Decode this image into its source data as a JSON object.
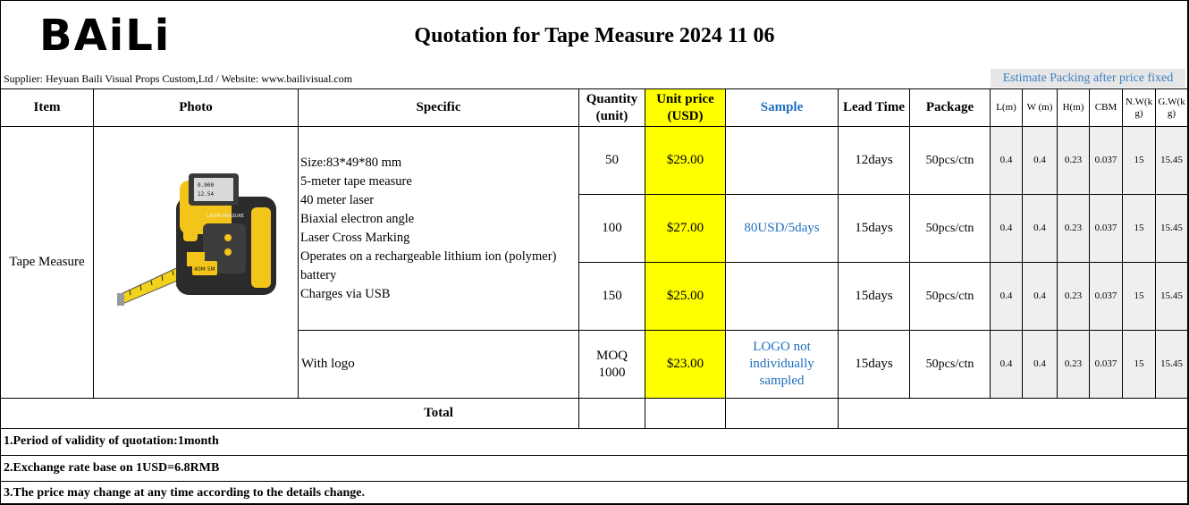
{
  "header": {
    "logo": "BAiLi",
    "title": "Quotation for  Tape Measure  2024 11 06",
    "supplier": "Supplier: Heyuan Baili Visual Props Custom,Ltd   / Website: www.bailivisual.com",
    "estimate": "Estimate Packing after price fixed"
  },
  "columns": {
    "item": "Item",
    "photo": "Photo",
    "specific": "Specific",
    "quantity": "Quantity (unit)",
    "unit_price": "Unit price (USD)",
    "sample": "Sample",
    "lead_time": "Lead Time",
    "package": "Package",
    "l": "L(m)",
    "w": "W (m)",
    "h": "H(m)",
    "cbm": "CBM",
    "nw": "N.W(kg)",
    "gw": "G.W(kg)"
  },
  "product": {
    "item": "Tape Measure",
    "photo_icon": "tape-measure-photo",
    "spec_lines": [
      "Size:83*49*80 mm",
      "5-meter tape measure",
      "40 meter laser",
      "Biaxial electron angle",
      "Laser Cross Marking",
      "Operates on a rechargeable lithium ion (polymer)",
      "battery",
      "Charges via USB"
    ],
    "logo_spec": "With logo",
    "sample": "80USD/5days",
    "logo_sample": "LOGO not individually sampled",
    "photo_labels": {
      "brand": "LASER MEASURE",
      "spec": "40M 5M"
    }
  },
  "rows": [
    {
      "qty": "50",
      "price": "$29.00",
      "lead": "12days",
      "package": "50pcs/ctn",
      "l": "0.4",
      "w": "0.4",
      "h": "0.23",
      "cbm": "0.037",
      "nw": "15",
      "gw": "15.45"
    },
    {
      "qty": "100",
      "price": "$27.00",
      "lead": "15days",
      "package": "50pcs/ctn",
      "l": "0.4",
      "w": "0.4",
      "h": "0.23",
      "cbm": "0.037",
      "nw": "15",
      "gw": "15.45"
    },
    {
      "qty": "150",
      "price": "$25.00",
      "lead": "15days",
      "package": "50pcs/ctn",
      "l": "0.4",
      "w": "0.4",
      "h": "0.23",
      "cbm": "0.037",
      "nw": "15",
      "gw": "15.45"
    },
    {
      "qty": "MOQ 1000",
      "price": "$23.00",
      "lead": "15days",
      "package": "50pcs/ctn",
      "l": "0.4",
      "w": "0.4",
      "h": "0.23",
      "cbm": "0.037",
      "nw": "15",
      "gw": "15.45"
    }
  ],
  "total_label": "Total",
  "notes": [
    "1.Period of validity of quotation:1month",
    "2.Exchange rate base on 1USD=6.8RMB",
    "3.The price may change at any time according to the details change."
  ]
}
